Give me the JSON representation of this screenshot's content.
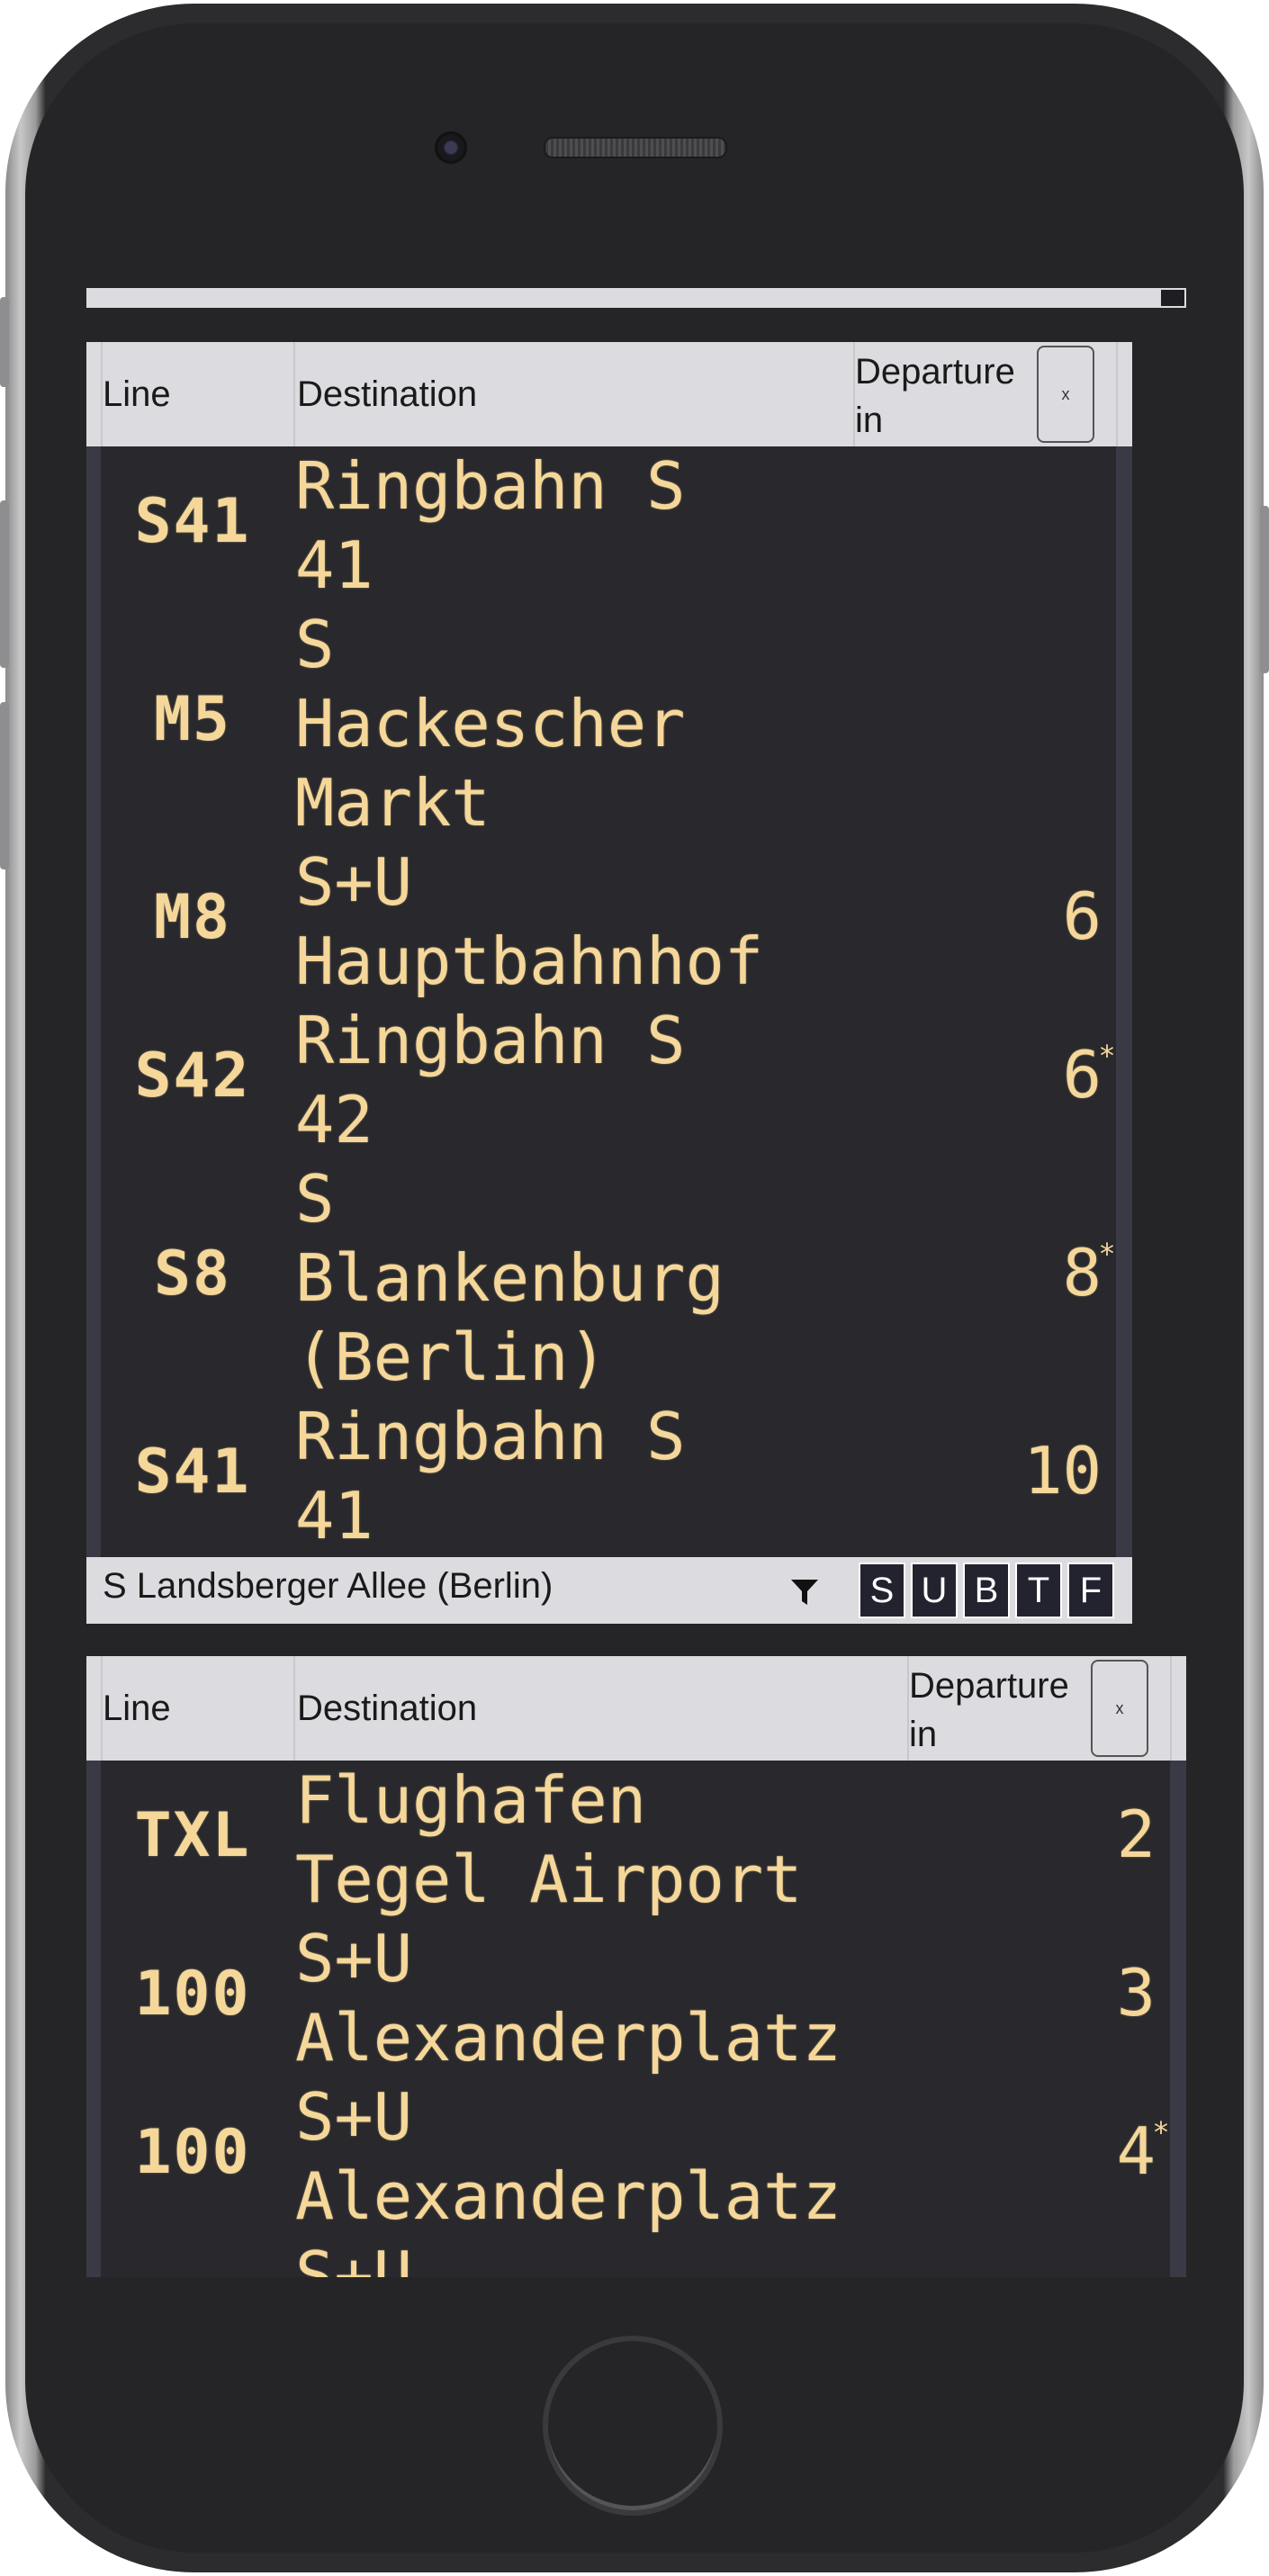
{
  "board1": {
    "headers": {
      "line": "Line",
      "destination": "Destination",
      "departure": "Departure in",
      "close": "x"
    },
    "rows": [
      {
        "line": "S41",
        "destination": "Ringbahn S\n41",
        "departure": "",
        "realtime": ""
      },
      {
        "line": "M5",
        "destination": "S\nHackescher\nMarkt",
        "departure": "",
        "realtime": ""
      },
      {
        "line": "M8",
        "destination": "S+U\nHauptbahnhof",
        "departure": "6",
        "realtime": ""
      },
      {
        "line": "S42",
        "destination": "Ringbahn S\n42",
        "departure": "6",
        "realtime": "*"
      },
      {
        "line": "S8",
        "destination": "S\nBlankenburg\n(Berlin)",
        "departure": "8",
        "realtime": "*"
      },
      {
        "line": "S41",
        "destination": "Ringbahn S\n41",
        "departure": "10",
        "realtime": ""
      }
    ]
  },
  "station2": {
    "name": "S Landsberger Allee (Berlin)",
    "filter_icon": "filter-icon",
    "modes": [
      "S",
      "U",
      "B",
      "T",
      "F"
    ]
  },
  "board2": {
    "headers": {
      "line": "Line",
      "destination": "Destination",
      "departure": "Departure in",
      "close": "x"
    },
    "rows": [
      {
        "line": "TXL",
        "destination": "Flughafen\nTegel Airport",
        "departure": "2",
        "realtime": ""
      },
      {
        "line": "100",
        "destination": "S+U\nAlexanderplatz",
        "departure": "3",
        "realtime": ""
      },
      {
        "line": "100",
        "destination": "S+U\nAlexanderplatz",
        "departure": "4",
        "realtime": "*"
      },
      {
        "line": "",
        "destination": "S+U",
        "departure": "",
        "realtime": ""
      }
    ]
  }
}
